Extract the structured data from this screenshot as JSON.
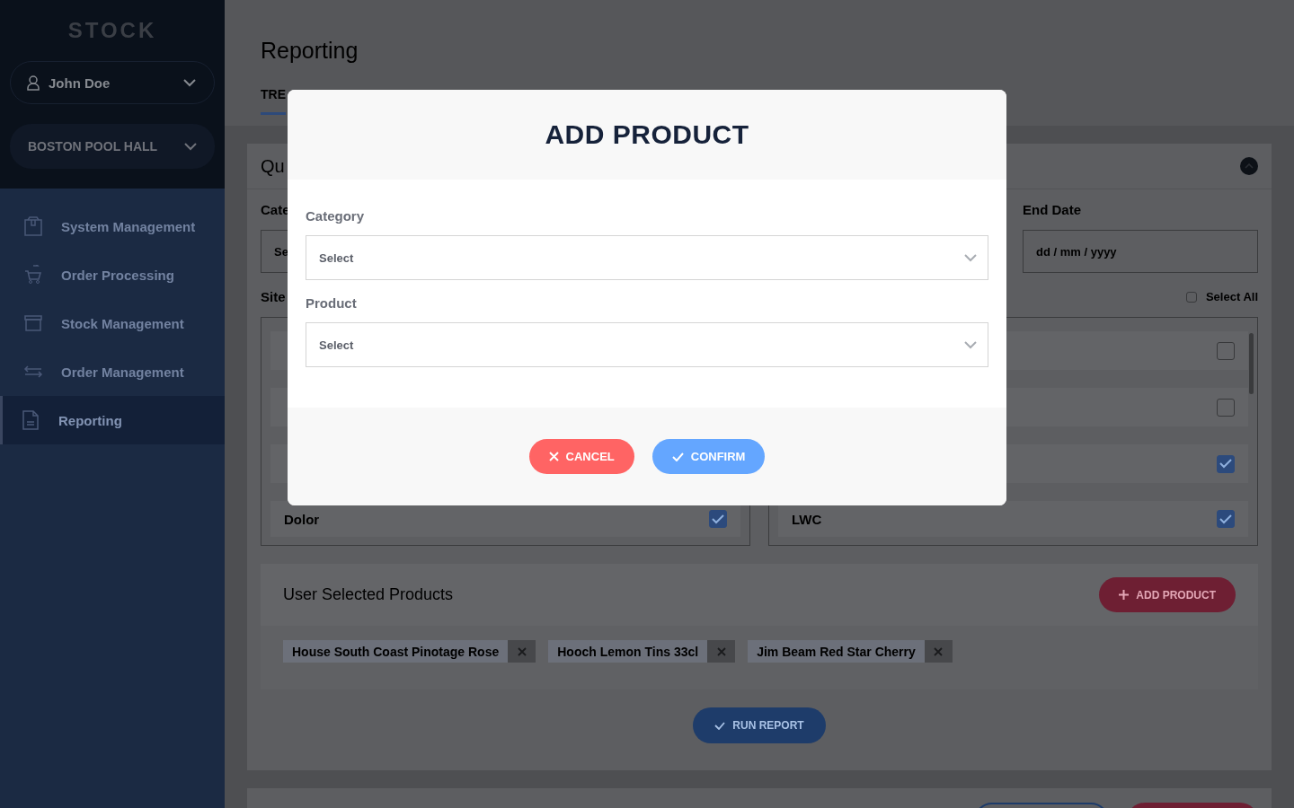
{
  "sidebar": {
    "logo": "STOCK",
    "user": "John Doe",
    "location": "BOSTON POOL HALL",
    "items": [
      {
        "label": "System Management",
        "selected": false
      },
      {
        "label": "Order Processing",
        "selected": false
      },
      {
        "label": "Stock Management",
        "selected": false
      },
      {
        "label": "Order Management",
        "selected": false
      },
      {
        "label": "Reporting",
        "selected": true
      }
    ]
  },
  "page": {
    "title": "Reporting",
    "tabs": [
      {
        "label": "TRE",
        "selected": true
      }
    ]
  },
  "query_panel": {
    "title": "Qu",
    "category": {
      "label": "Cate",
      "placeholder": "Se"
    },
    "end_date": {
      "label": "End Date",
      "placeholder": "dd / mm / yyyy"
    },
    "sites_label": "Site",
    "select_all": {
      "label": "Select All",
      "checked": false
    },
    "sites_left": [
      {
        "kind": "site"
      },
      {
        "kind": "site"
      },
      {
        "kind": "site"
      },
      {
        "kind": "site",
        "label": "Dolor",
        "checked": true
      }
    ],
    "sites_right": [
      {
        "kind": "site",
        "checked": false
      },
      {
        "kind": "site",
        "checked": false
      },
      {
        "kind": "site",
        "checked": true
      },
      {
        "kind": "site",
        "label": "LWC",
        "checked": true
      }
    ]
  },
  "user_selected_products": {
    "title": "User Selected Products",
    "add_button": "ADD PRODUCT",
    "chips": [
      "House South Coast Pinotage Rose",
      "Hooch Lemon Tins 33cl",
      "Jim Beam Red Star Cherry"
    ]
  },
  "run_report_button": "RUN REPORT",
  "modal": {
    "title": "ADD PRODUCT",
    "fields": [
      {
        "label": "Category",
        "value": "Select"
      },
      {
        "label": "Product",
        "value": "Select"
      }
    ],
    "buttons": [
      {
        "kind": "cancel",
        "label": "CANCEL"
      },
      {
        "kind": "confirm",
        "label": "CONFIRM"
      }
    ]
  }
}
